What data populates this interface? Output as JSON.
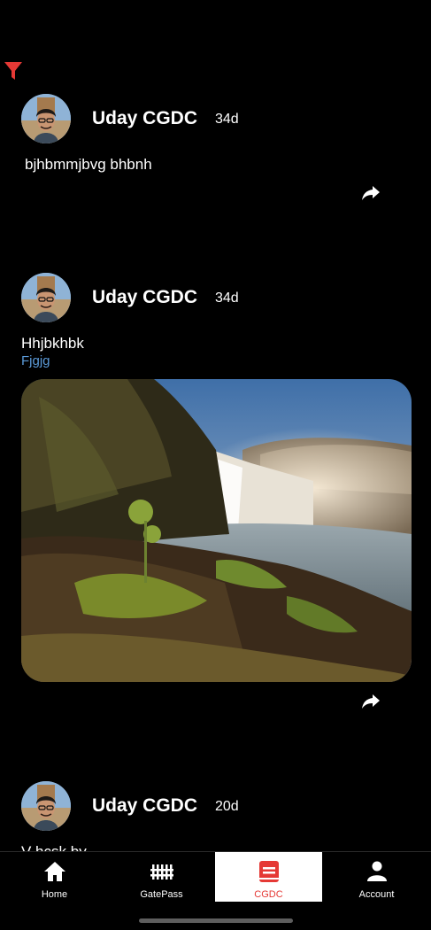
{
  "colors": {
    "accent": "#e53935",
    "link": "#5b9ad8",
    "background": "#000000"
  },
  "toolbar": {
    "filter_icon": "filter-icon"
  },
  "posts": [
    {
      "author": "Uday CGDC",
      "age": "34d",
      "text": "bjhbmmjbvg bhbnh"
    },
    {
      "author": "Uday CGDC",
      "age": "34d",
      "text": "Hhjbkhbk",
      "link": "Fjgjg",
      "image": "waterfall-photo"
    },
    {
      "author": "Uday CGDC",
      "age": "20d",
      "text": "V hcsk by"
    }
  ],
  "tabs": [
    {
      "label": "Home",
      "icon": "home-icon"
    },
    {
      "label": "GatePass",
      "icon": "gate-icon"
    },
    {
      "label": "CGDC",
      "icon": "cgdc-icon",
      "active": true
    },
    {
      "label": "Account",
      "icon": "account-icon"
    }
  ]
}
